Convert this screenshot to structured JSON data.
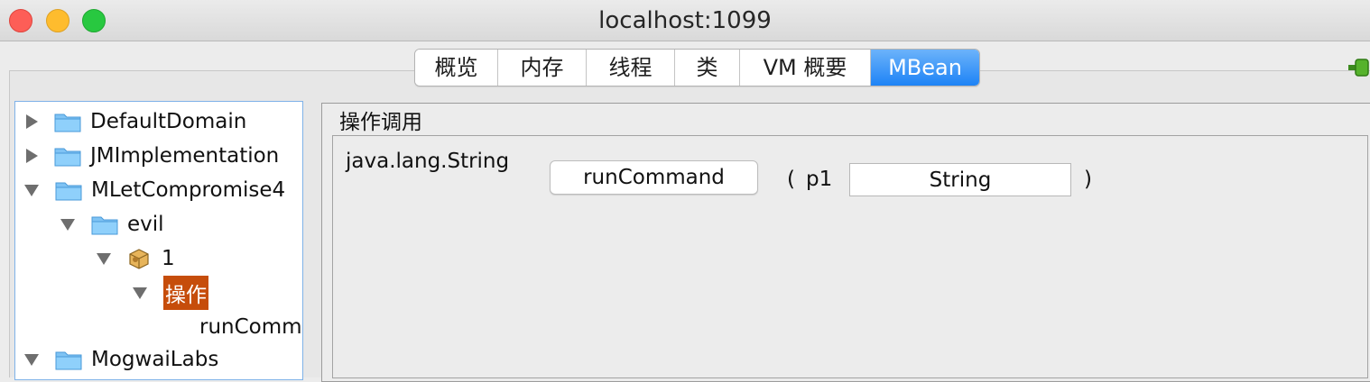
{
  "window": {
    "title": "localhost:1099"
  },
  "tabs": [
    {
      "label": "概览",
      "active": false
    },
    {
      "label": "内存",
      "active": false
    },
    {
      "label": "线程",
      "active": false
    },
    {
      "label": "类",
      "active": false
    },
    {
      "label": "VM 概要",
      "active": false
    },
    {
      "label": "MBean",
      "active": true
    }
  ],
  "tree": {
    "nodes": [
      {
        "label": "DefaultDomain",
        "icon": "folder-icon",
        "expanded": false
      },
      {
        "label": "JMImplementation",
        "icon": "folder-icon",
        "expanded": false
      },
      {
        "label": "MLetCompromise4",
        "icon": "folder-icon",
        "expanded": true
      },
      {
        "label": "evil",
        "icon": "folder-icon",
        "expanded": true
      },
      {
        "label": "1",
        "icon": "mbean-icon",
        "expanded": true
      },
      {
        "label": "操作",
        "icon": "none",
        "expanded": true,
        "selected": true
      },
      {
        "label": "runComm",
        "icon": "none"
      },
      {
        "label": "MogwaiLabs",
        "icon": "folder-icon",
        "expanded": true
      }
    ]
  },
  "operation_panel": {
    "title": "操作调用",
    "return_type": "java.lang.String",
    "operation_button": "runCommand",
    "paren_open": "(",
    "param_name": "p1",
    "param_value": "String",
    "paren_close": ")"
  },
  "colors": {
    "active_tab": "#1d83f6",
    "selected_node": "#c64d0b",
    "tree_border": "#7fb2e8"
  }
}
